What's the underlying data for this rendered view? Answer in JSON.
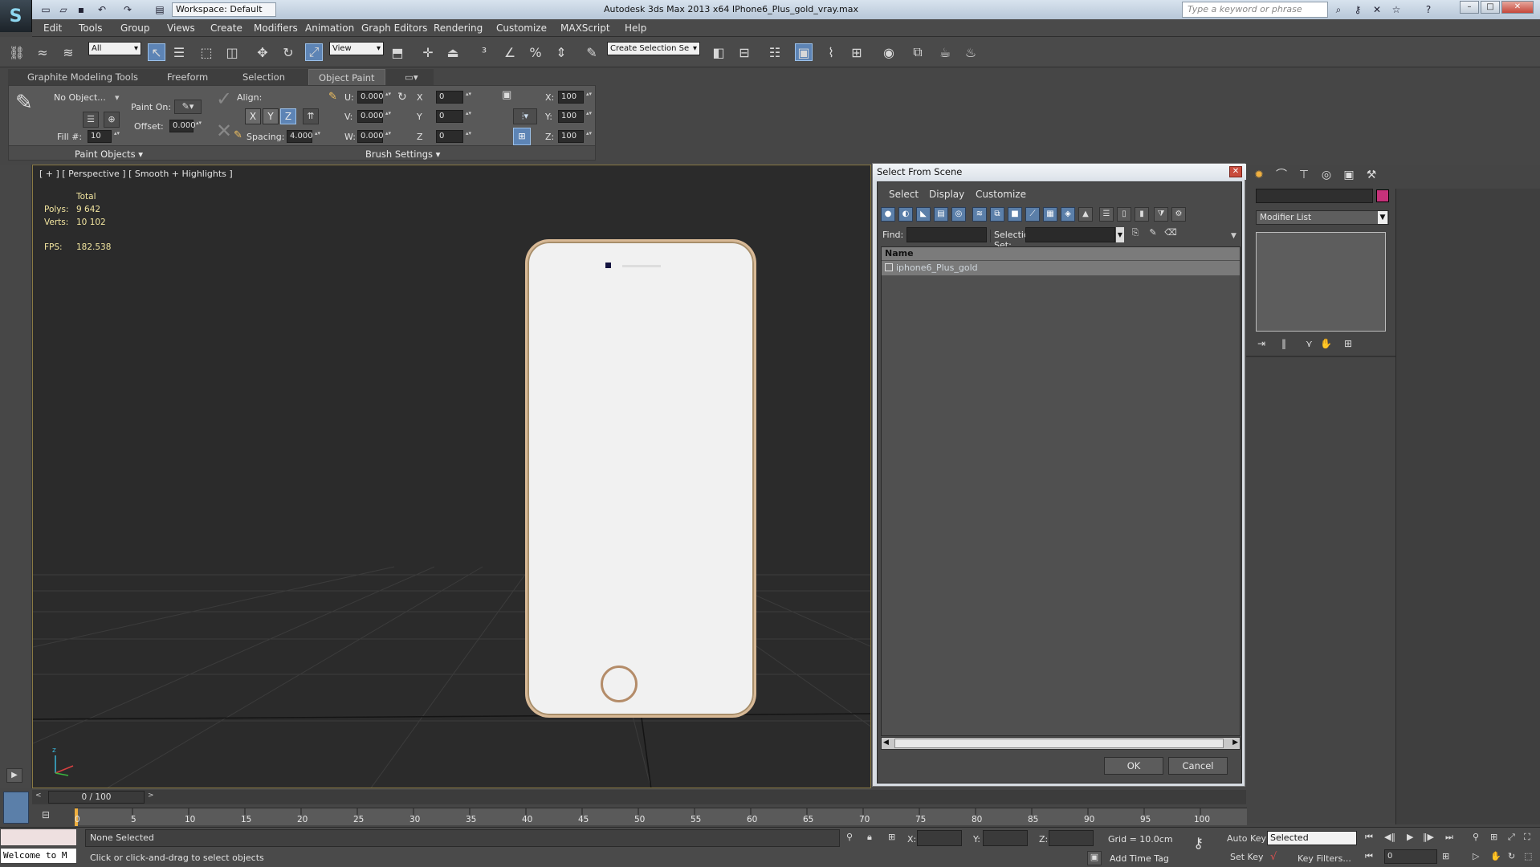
{
  "window": {
    "title": "Autodesk 3ds Max  2013 x64     IPhone6_Plus_gold_vray.max",
    "workspace": "Workspace: Default",
    "search_placeholder": "Type a keyword or phrase"
  },
  "menu": [
    "Edit",
    "Tools",
    "Group",
    "Views",
    "Create",
    "Modifiers",
    "Animation",
    "Graph Editors",
    "Rendering",
    "Customize",
    "MAXScript",
    "Help"
  ],
  "toolbar": {
    "filter": "All",
    "coord_system": "View",
    "selection_set": "Create Selection Se"
  },
  "ribbon": {
    "tabs": [
      "Graphite Modeling Tools",
      "Freeform",
      "Selection",
      "Object Paint"
    ],
    "no_object": "No Object...",
    "paint_on": "Paint On:",
    "offset_label": "Offset:",
    "offset": "0.000",
    "fill_label": "Fill #:",
    "fill": "10",
    "align": "Align:",
    "x": "X",
    "y": "Y",
    "z": "Z",
    "spacing_label": "Spacing:",
    "spacing": "4.000",
    "u_label": "U:",
    "u": "0.000",
    "v_label": "V:",
    "v": "0.000",
    "w_label": "W:",
    "w": "0.000",
    "rx_label": "X",
    "rx": "0",
    "ry_label": "Y",
    "ry": "0",
    "rz_label": "Z",
    "rz": "0",
    "sx_label": "X:",
    "sx": "100",
    "sy_label": "Y:",
    "sy": "100",
    "sz_label": "Z:",
    "sz": "100",
    "paint_objects": "Paint Objects",
    "brush_settings": "Brush Settings"
  },
  "viewport": {
    "label": "[ + ] [ Perspective ] [ Smooth + Highlights ]",
    "total": "Total",
    "polys_label": "Polys:",
    "polys": "9 642",
    "verts_label": "Verts:",
    "verts": "10 102",
    "fps_label": "FPS:",
    "fps": "182.538"
  },
  "dialog": {
    "title": "Select From Scene",
    "menus": [
      "Select",
      "Display",
      "Customize"
    ],
    "find_label": "Find:",
    "selset_label": "Selection Set:",
    "col_name": "Name",
    "object": "iphone6_Plus_gold",
    "ok": "OK",
    "cancel": "Cancel"
  },
  "cmd": {
    "modifier_list": "Modifier List"
  },
  "time": {
    "slider": "0 / 100",
    "ticks": [
      "0",
      "5",
      "10",
      "15",
      "20",
      "25",
      "30",
      "35",
      "40",
      "45",
      "50",
      "55",
      "60",
      "65",
      "70",
      "75",
      "80",
      "85",
      "90",
      "95",
      "100"
    ]
  },
  "status": {
    "welcome": "Welcome to M",
    "none_selected": "None Selected",
    "hint": "Click or click-and-drag to select objects",
    "x_label": "X:",
    "y_label": "Y:",
    "z_label": "Z:",
    "grid": "Grid = 10.0cm",
    "add_time_tag": "Add Time Tag",
    "auto_key": "Auto Key",
    "set_key": "Set Key",
    "key_mode": "Selected",
    "key_filters": "Key Filters...",
    "frame": "0"
  },
  "colors": {
    "accent": "#5d84b5",
    "viewport_border": "#8a7a44",
    "object_color": "#c6327a",
    "phone_rim": "#d8b996"
  }
}
